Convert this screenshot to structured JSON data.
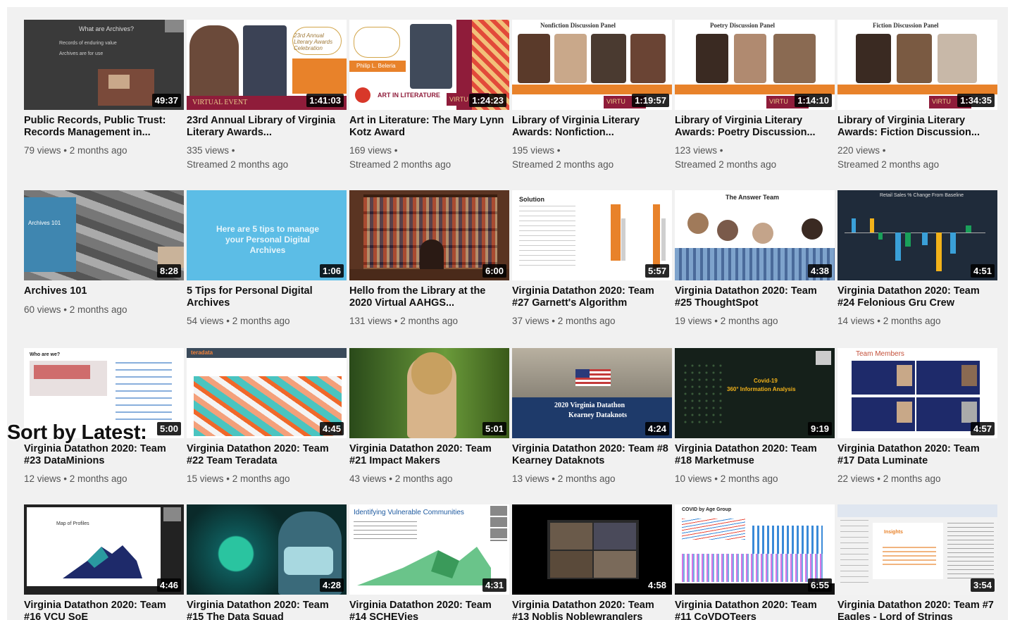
{
  "overlay": {
    "sort_label": "Sort by Latest:"
  },
  "videos": [
    {
      "title": "Public Records, Public Trust: Records Management in...",
      "duration": "49:37",
      "meta1": "79 views • 2 months ago",
      "meta2": "",
      "thumb_text": [
        "What are Archives?",
        "Records of enduring value",
        "Archives are for use"
      ]
    },
    {
      "title": "23rd Annual Library of Virginia Literary Awards...",
      "duration": "1:41:03",
      "meta1": "335 views •",
      "meta2": "Streamed 2 months ago",
      "thumb_text": [
        "VIRTUAL EVENT",
        "23rd Annual Literary Awards Celebration"
      ]
    },
    {
      "title": "Art in Literature: The Mary Lynn Kotz Award",
      "duration": "1:24:23",
      "meta1": "169 views •",
      "meta2": "Streamed 2 months ago",
      "thumb_text": [
        "Philip L. Beleria",
        "ART IN LITERATURE",
        "VIRTU"
      ]
    },
    {
      "title": "Library of Virginia Literary Awards: Nonfiction...",
      "duration": "1:19:57",
      "meta1": "195 views •",
      "meta2": "Streamed 2 months ago",
      "thumb_text": [
        "Nonfiction Discussion Panel",
        "VIRTU"
      ]
    },
    {
      "title": "Library of Virginia Literary Awards: Poetry Discussion...",
      "duration": "1:14:10",
      "meta1": "123 views •",
      "meta2": "Streamed 2 months ago",
      "thumb_text": [
        "Poetry Discussion Panel",
        "VIRTU"
      ]
    },
    {
      "title": "Library of Virginia Literary Awards: Fiction Discussion...",
      "duration": "1:34:35",
      "meta1": "220 views •",
      "meta2": "Streamed 2 months ago",
      "thumb_text": [
        "Fiction Discussion Panel",
        "VIRTU"
      ]
    },
    {
      "title": "Archives 101",
      "duration": "8:28",
      "meta1": "60 views • 2 months ago",
      "meta2": "",
      "thumb_text": [
        "Archives 101"
      ]
    },
    {
      "title": "5 Tips for Personal Digital Archives",
      "duration": "1:06",
      "meta1": "54 views • 2 months ago",
      "meta2": "",
      "thumb_text": [
        "Here are 5 tips to manage your Personal Digital Archives"
      ]
    },
    {
      "title": "Hello from the Library at the 2020 Virtual AAHGS...",
      "duration": "6:00",
      "meta1": "131 views • 2 months ago",
      "meta2": "",
      "thumb_text": []
    },
    {
      "title": "Virginia Datathon 2020: Team #27 Garnett's Algorithm",
      "duration": "5:57",
      "meta1": "37 views • 2 months ago",
      "meta2": "",
      "thumb_text": [
        "Solution"
      ]
    },
    {
      "title": "Virginia Datathon 2020: Team #25 ThoughtSpot",
      "duration": "4:38",
      "meta1": "19 views • 2 months ago",
      "meta2": "",
      "thumb_text": [
        "The Answer Team"
      ]
    },
    {
      "title": "Virginia Datathon 2020: Team #24 Felonious Gru Crew",
      "duration": "4:51",
      "meta1": "14 views • 2 months ago",
      "meta2": "",
      "thumb_text": [
        "Retail Sales % Change From Baseline"
      ]
    },
    {
      "title": "Virginia Datathon 2020: Team #23 DataMinions",
      "duration": "5:00",
      "meta1": "12 views • 2 months ago",
      "meta2": "",
      "thumb_text": [
        "Who are we?"
      ]
    },
    {
      "title": "Virginia Datathon 2020: Team #22 Team Teradata",
      "duration": "4:45",
      "meta1": "15 views • 2 months ago",
      "meta2": "",
      "thumb_text": [
        "teradata"
      ]
    },
    {
      "title": "Virginia Datathon 2020: Team #21 Impact Makers",
      "duration": "5:01",
      "meta1": "43 views • 2 months ago",
      "meta2": "",
      "thumb_text": []
    },
    {
      "title": "Virginia Datathon 2020: Team #8 Kearney Dataknots",
      "duration": "4:24",
      "meta1": "13 views • 2 months ago",
      "meta2": "",
      "thumb_text": [
        "2020 Virginia Datathon",
        "Kearney Dataknots"
      ]
    },
    {
      "title": "Virginia Datathon 2020: Team #18 Marketmuse",
      "duration": "9:19",
      "meta1": "10 views • 2 months ago",
      "meta2": "",
      "thumb_text": [
        "Covid-19",
        "360° Information Analysis"
      ]
    },
    {
      "title": "Virginia Datathon 2020: Team #17 Data Luminate",
      "duration": "4:57",
      "meta1": "22 views • 2 months ago",
      "meta2": "",
      "thumb_text": [
        "Team Members"
      ]
    },
    {
      "title": "Virginia Datathon 2020: Team #16 VCU SoE",
      "duration": "4:46",
      "meta1": "",
      "meta2": "",
      "thumb_text": [
        "Map of Profiles"
      ]
    },
    {
      "title": "Virginia Datathon 2020: Team #15 The Data Squad",
      "duration": "4:28",
      "meta1": "",
      "meta2": "",
      "thumb_text": []
    },
    {
      "title": "Virginia Datathon 2020: Team #14 SCHEVies",
      "duration": "4:31",
      "meta1": "",
      "meta2": "",
      "thumb_text": [
        "Identifying Vulnerable Communities"
      ]
    },
    {
      "title": "Virginia Datathon 2020: Team #13 Noblis Noblewranglers",
      "duration": "4:58",
      "meta1": "",
      "meta2": "",
      "thumb_text": []
    },
    {
      "title": "Virginia Datathon 2020: Team #11 CoVDOTeers",
      "duration": "6:55",
      "meta1": "",
      "meta2": "",
      "thumb_text": [
        "COVID by Age Group"
      ]
    },
    {
      "title": "Virginia Datathon 2020: Team #7 Eagles - Lord of Strings",
      "duration": "3:54",
      "meta1": "",
      "meta2": "",
      "thumb_text": [
        "Insights"
      ]
    }
  ]
}
